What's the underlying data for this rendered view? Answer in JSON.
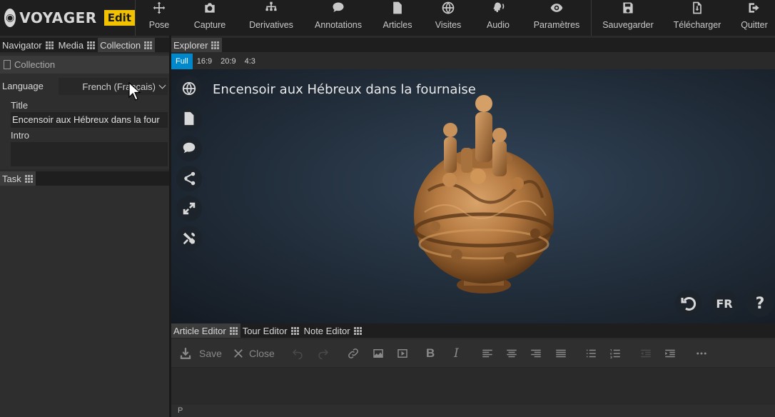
{
  "app": {
    "name": "VOYAGER",
    "mode_badge": "Edit"
  },
  "toolbar": {
    "items": [
      {
        "label": "Pose",
        "icon": "move-icon"
      },
      {
        "label": "Capture",
        "icon": "camera-icon"
      },
      {
        "label": "Derivatives",
        "icon": "hierarchy-icon"
      },
      {
        "label": "Annotations",
        "icon": "comment-icon"
      },
      {
        "label": "Articles",
        "icon": "file-icon"
      },
      {
        "label": "Visites",
        "icon": "globe-icon"
      },
      {
        "label": "Audio",
        "icon": "audio-icon"
      },
      {
        "label": "Paramètres",
        "icon": "eye-icon"
      },
      {
        "label": "Sauvegarder",
        "icon": "save-icon"
      },
      {
        "label": "Télécharger",
        "icon": "download-icon"
      },
      {
        "label": "Quitter",
        "icon": "exit-icon"
      }
    ]
  },
  "left_tabs": {
    "navigator": "Navigator",
    "media": "Media",
    "collection": "Collection"
  },
  "collection_panel": {
    "header": "Collection",
    "language_label": "Language",
    "language_value": "French (Français)",
    "title_label": "Title",
    "title_value": "Encensoir aux Hébreux dans la four",
    "intro_label": "Intro",
    "intro_value": ""
  },
  "task_tab": "Task",
  "explorer": {
    "tab": "Explorer",
    "aspects": [
      "Full",
      "16:9",
      "20:9",
      "4:3"
    ],
    "active_aspect": "Full",
    "scene_title": "Encensoir aux Hébreux dans la fournaise",
    "side_buttons": [
      "globe-icon",
      "document-icon",
      "comment-icon",
      "share-icon",
      "expand-icon",
      "tools-icon"
    ],
    "language_button": "FR",
    "help_button": "?"
  },
  "editor_tabs": {
    "article": "Article Editor",
    "tour": "Tour Editor",
    "note": "Note Editor"
  },
  "article_editor": {
    "save_label": "Save",
    "close_label": "Close",
    "status_path": "P"
  }
}
